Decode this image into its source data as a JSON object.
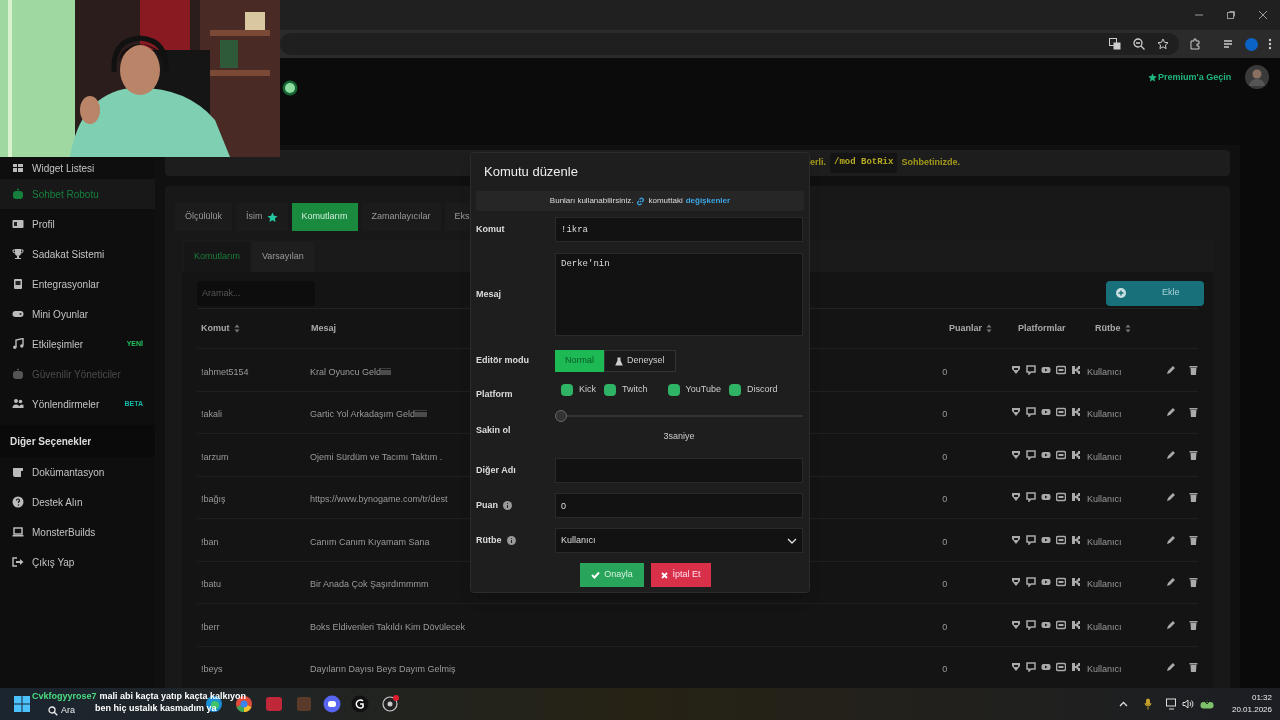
{
  "header": {
    "premium_link": "Premium'a Geçin"
  },
  "sidebar": {
    "items": [
      {
        "label": "Widget Listesi",
        "selected": false,
        "disabled": false
      },
      {
        "label": "Sohbet Robotu",
        "selected": true,
        "disabled": false
      },
      {
        "label": "Profil",
        "selected": false,
        "disabled": false
      },
      {
        "label": "Sadakat Sistemi",
        "selected": false,
        "disabled": false
      },
      {
        "label": "Entegrasyonlar",
        "selected": false,
        "disabled": false
      },
      {
        "label": "Mini Oyunlar",
        "selected": false,
        "disabled": false
      },
      {
        "label": "Etkileşimler",
        "selected": false,
        "disabled": false,
        "badge": {
          "label": "YENİ",
          "color": "#22c55e"
        }
      },
      {
        "label": "Güvenilir Yöneticiler",
        "selected": false,
        "disabled": true
      },
      {
        "label": "Yönlendirmeler",
        "selected": false,
        "disabled": false,
        "badge": {
          "label": "BETA",
          "color": "#14b8a6"
        }
      }
    ],
    "section_title": "Diğer Seçenekler",
    "other_items": [
      {
        "label": "Dokümantasyon"
      },
      {
        "label": "Destek Alın"
      },
      {
        "label": "MonsterBuilds"
      },
      {
        "label": "Çıkış Yap"
      }
    ]
  },
  "banner": {
    "text_before": "erli.",
    "code": "/mod BotRix",
    "text_after": "Sohbetinizde."
  },
  "tabs": [
    {
      "label": "Ölçülülük",
      "selected": false,
      "starred": false
    },
    {
      "label": "İsim",
      "selected": false,
      "starred": true
    },
    {
      "label": "Komutlarım",
      "selected": true,
      "starred": false
    },
    {
      "label": "Zamanlayıcılar",
      "selected": false,
      "starred": false
    },
    {
      "label": "Eks",
      "selected": false,
      "starred": false
    }
  ],
  "subtabs": [
    {
      "label": "Komutlarım",
      "selected": true
    },
    {
      "label": "Varsayılan",
      "selected": false
    }
  ],
  "search": {
    "placeholder": "Aramak..."
  },
  "add_button": "Ekle",
  "table": {
    "columns": [
      {
        "label": "Komut",
        "sortable": true
      },
      {
        "label": "Mesaj",
        "sortable": false
      },
      {
        "label": "Puanlar",
        "sortable": true
      },
      {
        "label": "Platformlar",
        "sortable": false
      },
      {
        "label": "Rütbe",
        "sortable": true
      }
    ],
    "rows": [
      {
        "command": "!ahmet5154",
        "message": "Kral Oyuncu Geldiiiii",
        "points": "0",
        "rank": "Kullanıcı"
      },
      {
        "command": "!akali",
        "message": "Gartic Yol Arkadaşım Geldiiiiii",
        "points": "0",
        "rank": "Kullanıcı"
      },
      {
        "command": "!arzum",
        "message": "Ojemi Sürdüm ve Tacımı Taktım .",
        "points": "0",
        "rank": "Kullanıcı"
      },
      {
        "command": "!bağış",
        "message": "https://www.bynogame.com/tr/dest",
        "points": "0",
        "rank": "Kullanıcı"
      },
      {
        "command": "!ban",
        "message": "Canım Canım Kıyamam Sana",
        "points": "0",
        "rank": "Kullanıcı"
      },
      {
        "command": "!batu",
        "message": "Bir Anada Çok Şaşırdımmmm",
        "points": "0",
        "rank": "Kullanıcı"
      },
      {
        "command": "!berr",
        "message": "Boks Eldivenleri Takıldı Kim Dövülecek",
        "points": "0",
        "rank": "Kullanıcı"
      },
      {
        "command": "!beys",
        "message": "Dayıların Dayısı Beys Dayım Gelmiş",
        "points": "0",
        "rank": "Kullanıcı"
      }
    ]
  },
  "modal": {
    "title": "Komutu düzenle",
    "info_text": "Bunları kullanabilirsiniz.",
    "info_text2": "komuttaki",
    "info_link": "değişkenler",
    "command": {
      "label": "Komut",
      "value": "!ikra"
    },
    "message": {
      "label": "Mesaj",
      "value": "Derke'nin"
    },
    "editor_mode": {
      "label": "Editör modu",
      "options": [
        {
          "label": "Normal",
          "selected": true
        },
        {
          "label": "Deneysel",
          "selected": false
        }
      ]
    },
    "platform": {
      "label": "Platform",
      "options": [
        {
          "label": "Kick",
          "checked": true
        },
        {
          "label": "Twitch",
          "checked": true
        },
        {
          "label": "YouTube",
          "checked": true
        },
        {
          "label": "Discord",
          "checked": true
        }
      ]
    },
    "cooldown": {
      "label": "Sakin ol",
      "level": 0,
      "reading": "3saniye"
    },
    "alias": {
      "label": "Diğer Adı"
    },
    "points": {
      "label": "Puan",
      "value": "0"
    },
    "rank": {
      "label": "Rütbe",
      "value": "Kullanıcı"
    },
    "confirm_button": "Onayla",
    "cancel_button": "İptal Et"
  },
  "chat_overlay": [
    {
      "user": "Cvkfogyyrose7",
      "color": "#4ade80",
      "message": "mali abi kaçta yatıp kaçta kalkıyon"
    },
    {
      "message": "ben hiç ustalık kasmadım ya"
    }
  ],
  "taskbar": {
    "search": "Ara",
    "time": "01:32",
    "date": "20.01.2026"
  }
}
